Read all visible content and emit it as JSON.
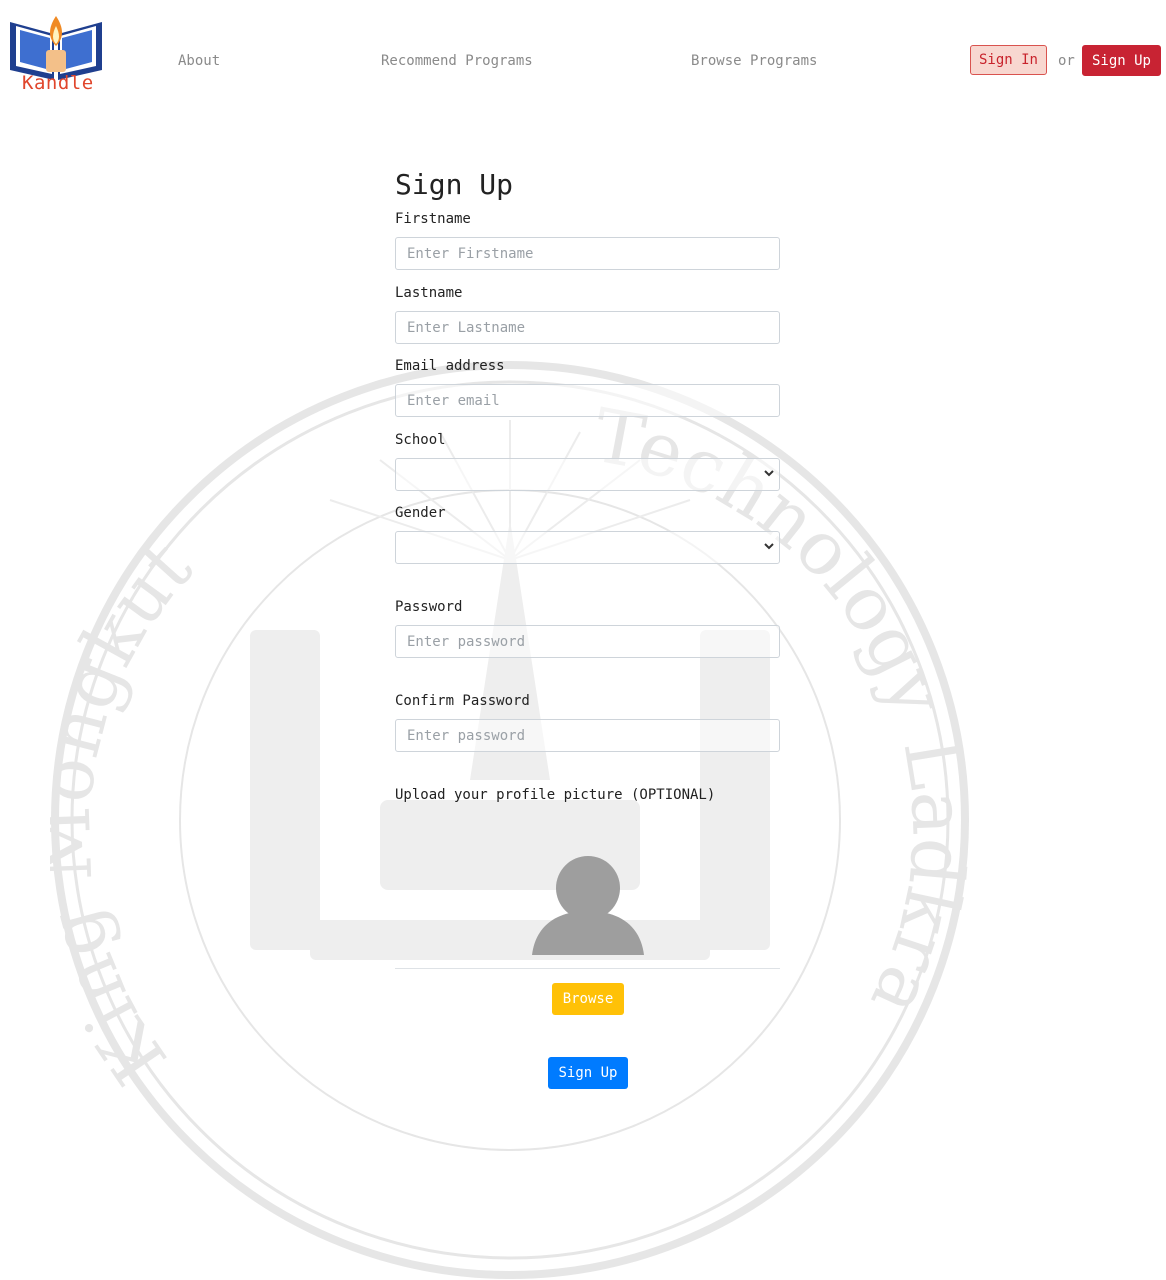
{
  "brand": {
    "name": "Kandle"
  },
  "nav": {
    "links": [
      "About",
      "Recommend Programs",
      "Browse Programs"
    ],
    "sign_in": "Sign In",
    "or": "or",
    "sign_up": "Sign Up"
  },
  "watermark": {
    "top_text": "King Mongkut",
    "right_text": "Technology Ladkrabang"
  },
  "form": {
    "title": "Sign Up",
    "firstname": {
      "label": "Firstname",
      "placeholder": "Enter Firstname"
    },
    "lastname": {
      "label": "Lastname",
      "placeholder": "Enter Lastname"
    },
    "email": {
      "label": "Email address",
      "placeholder": "Enter email"
    },
    "school": {
      "label": "School",
      "value": ""
    },
    "gender": {
      "label": "Gender",
      "value": ""
    },
    "password": {
      "label": "Password",
      "placeholder": "Enter password"
    },
    "confirm": {
      "label": "Confirm Password",
      "placeholder": "Enter password"
    },
    "upload_label": "Upload your profile picture (OPTIONAL)",
    "browse": "Browse",
    "submit": "Sign Up"
  },
  "colors": {
    "danger": "#c82333",
    "warning": "#ffc107",
    "primary": "#007bff",
    "brand_text": "#e0462c"
  }
}
